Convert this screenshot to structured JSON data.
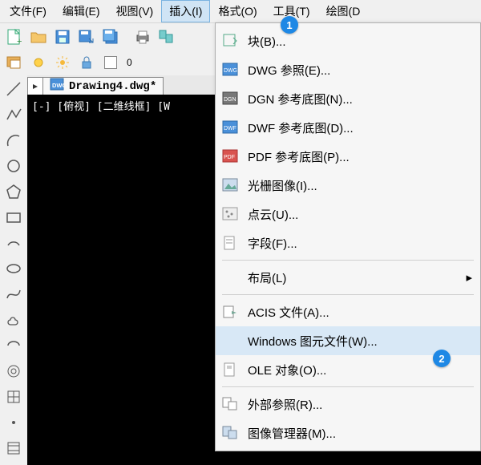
{
  "menubar": {
    "file": "文件(F)",
    "edit": "编辑(E)",
    "view": "视图(V)",
    "insert": "插入(I)",
    "format": "格式(O)",
    "tools": "工具(T)",
    "draw": "绘图(D"
  },
  "toolbar2": {
    "zero": "0"
  },
  "document": {
    "tab_title": "Drawing4.dwg*",
    "status_line": "[-] [俯视] [二维线框] [W"
  },
  "insert_menu": {
    "block": "块(B)...",
    "dwg_ref": "DWG 参照(E)...",
    "dgn_underlay": "DGN 参考底图(N)...",
    "dwf_underlay": "DWF 参考底图(D)...",
    "pdf_underlay": "PDF 参考底图(P)...",
    "raster": "光栅图像(I)...",
    "point_cloud": "点云(U)...",
    "field": "字段(F)...",
    "layout": "布局(L)",
    "acis": "ACIS 文件(A)...",
    "wmf": "Windows 图元文件(W)...",
    "ole": "OLE 对象(O)...",
    "xref": "外部参照(R)...",
    "image_mgr": "图像管理器(M)..."
  },
  "badges": {
    "one": "1",
    "two": "2"
  }
}
